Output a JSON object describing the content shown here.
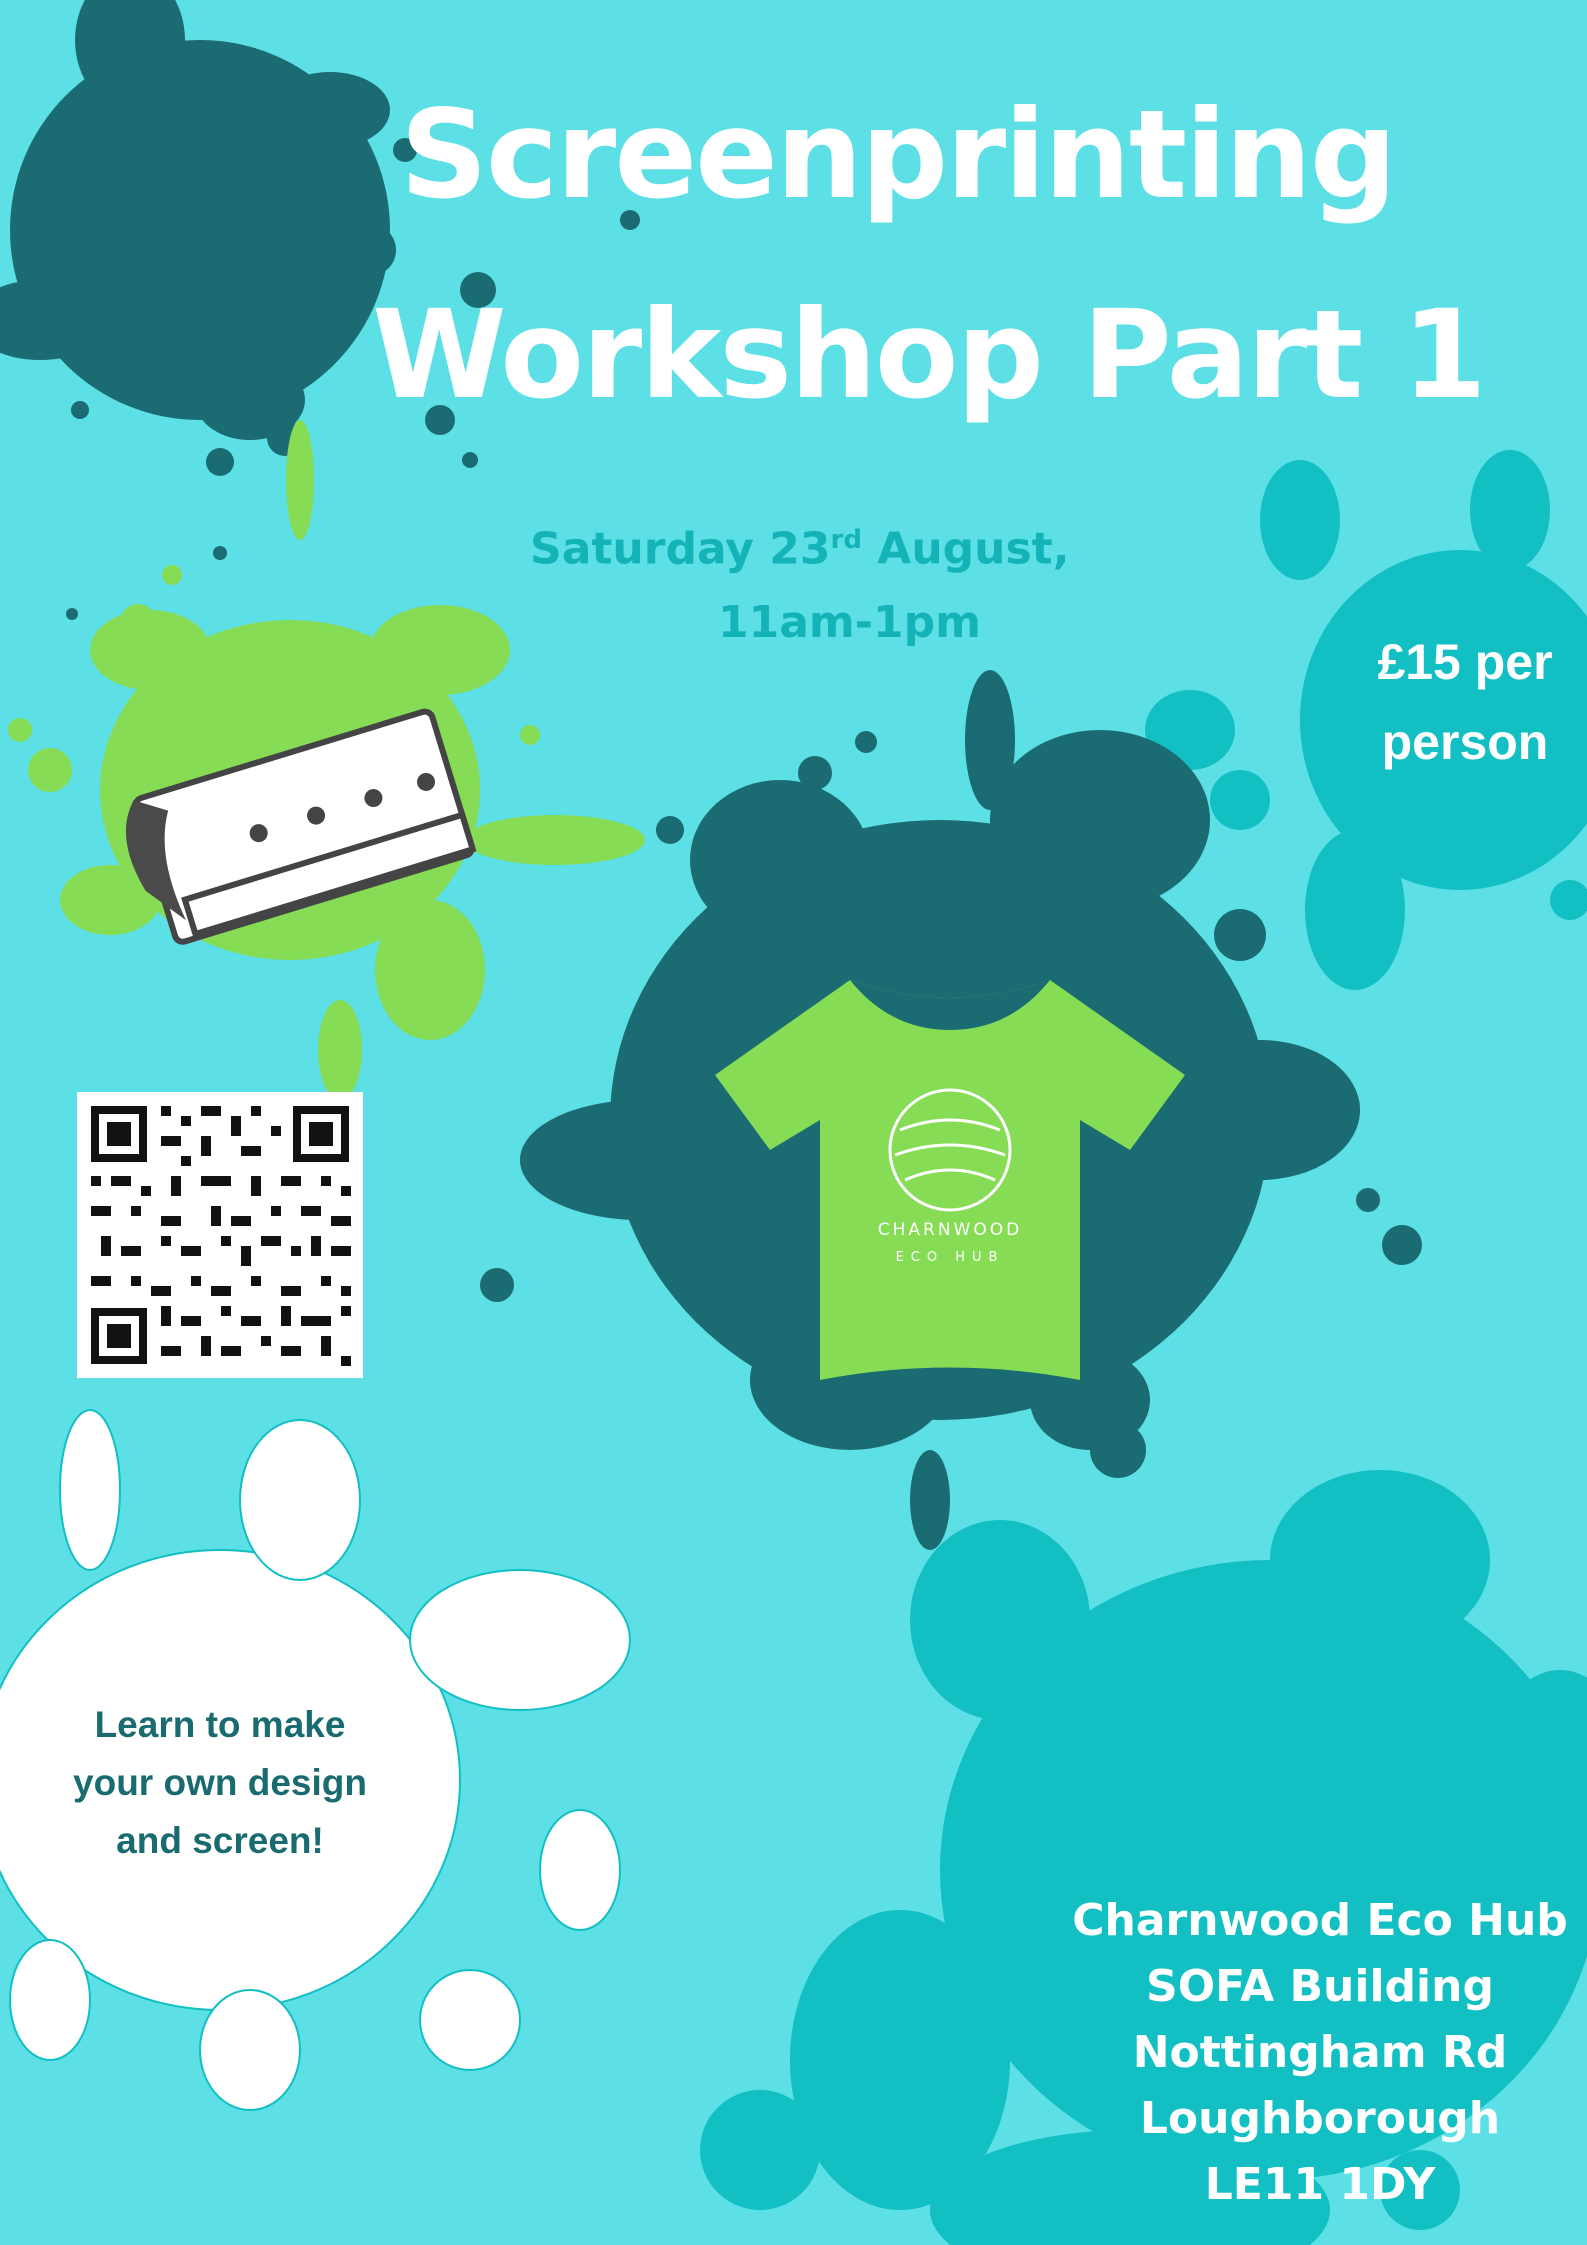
{
  "poster": {
    "title_line1": "Screenprinting",
    "title_line2": "Workshop Part 1",
    "date_day": "Saturday 23",
    "date_suffix": "rd",
    "date_month": "August,",
    "time": "11am-1pm",
    "price_line1": "£15 per",
    "price_line2": "person",
    "learn_line1": "Learn to make",
    "learn_line2": "your own design",
    "learn_line3": "and screen!",
    "logo_line1": "CHARNWOOD",
    "logo_line2": "ECO HUB",
    "address": [
      "Charnwood Eco Hub",
      "SOFA Building",
      "Nottingham Rd",
      "Loughborough",
      "LE11 1DY"
    ]
  },
  "colors": {
    "background": "#5ce0e6",
    "dark_teal": "#1b6b72",
    "mid_teal": "#12bfc3",
    "lime": "#86dc55",
    "white": "#ffffff"
  },
  "icons": [
    "paint-splat-icon",
    "squeegee-icon",
    "tshirt-icon",
    "leaf-logo-icon",
    "qr-code-icon"
  ]
}
